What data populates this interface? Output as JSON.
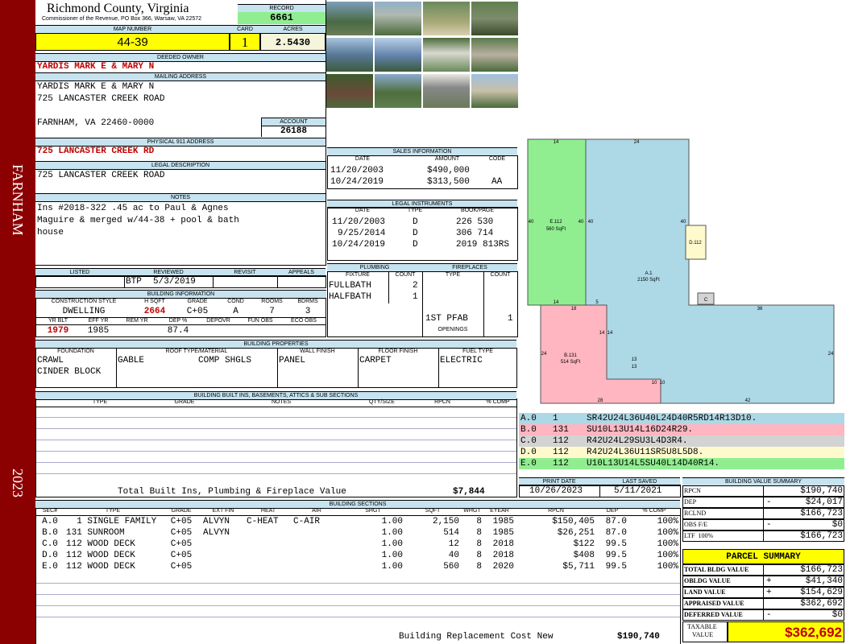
{
  "side_band": {
    "location": "FARNHAM",
    "year": "2023"
  },
  "header": {
    "county": "Richmond County, Virginia",
    "subtitle": "Commissioner of the Revenue, PO Box 366, Warsaw, VA 22572",
    "record_label": "RECORD",
    "record": "6661"
  },
  "parcel": {
    "map_label": "MAP NUMBER",
    "map_number": "44-39",
    "card_label": "CARD",
    "card": "1",
    "acres_label": "ACRES",
    "acres": "2.5430"
  },
  "owner": {
    "deeded_label": "DEEDED OWNER",
    "deeded": "YARDIS MARK E & MARY N",
    "mailing_label": "MAILING ADDRESS",
    "mailing_line1": "YARDIS MARK E & MARY N",
    "mailing_line2": "725 LANCASTER CREEK ROAD",
    "mailing_line3": "FARNHAM, VA 22460-0000",
    "account_label": "ACCOUNT",
    "account": "26188"
  },
  "physical": {
    "label": "PHYSICAL 911 ADDRESS",
    "address": "725 LANCASTER CREEK RD"
  },
  "legal": {
    "label": "LEGAL DESCRIPTION",
    "text": "725 LANCASTER CREEK ROAD"
  },
  "notes": {
    "label": "NOTES",
    "line1": "Ins #2018-322 .45 ac to Paul & Agnes",
    "line2": "Maguire & merged w/44-38 + pool & bath",
    "line3": "house"
  },
  "sales": {
    "label": "SALES INFORMATION",
    "cols": [
      "DATE",
      "AMOUNT",
      "CODE"
    ],
    "rows": [
      [
        "11/20/2003",
        "$490,000",
        ""
      ],
      [
        "10/24/2019",
        "$313,500",
        "AA"
      ]
    ]
  },
  "legal_instruments": {
    "label": "LEGAL INSTRUMENTS",
    "cols": [
      "DATE",
      "TYPE",
      "BOOK/PAGE"
    ],
    "rows": [
      [
        "11/20/2003",
        "D",
        "226 530"
      ],
      [
        "9/25/2014",
        "D",
        "306 714"
      ],
      [
        "10/24/2019",
        "D",
        "2019 813RS"
      ]
    ]
  },
  "listing": {
    "listed_label": "LISTED",
    "reviewed_label": "REVIEWED",
    "revisit_label": "REVISIT",
    "appeals_label": "APPEALS",
    "reviewer": "BTP",
    "reviewed": "5/3/2019"
  },
  "building_info": {
    "label": "BUILDING INFORMATION",
    "c1": "CONSTRUCTION STYLE",
    "c2": "H SQFT",
    "c3": "GRADE",
    "c4": "COND",
    "c5": "ROOMS",
    "c6": "BDRMS",
    "style": "DWELLING",
    "hsqft": "2664",
    "grade": "C+05",
    "cond": "A",
    "rooms": "7",
    "bdrms": "3",
    "d1": "YR BLT",
    "d2": "EFF YR",
    "d3": "REM YR",
    "d4": "DEP %",
    "d5": "DEPOVR",
    "d6": "FUN OBS",
    "d7": "ECO OBS",
    "yrblt": "1979",
    "effyr": "1985",
    "dep": "87.4"
  },
  "plumbing": {
    "label": "PLUMBING",
    "fixture_label": "FIXTURE",
    "count_label": "COUNT",
    "rows": [
      [
        "FULLBATH",
        "2"
      ],
      [
        "HALFBATH",
        "1"
      ]
    ]
  },
  "fireplaces": {
    "label": "FIREPLACES",
    "type_label": "TYPE",
    "count_label": "COUNT",
    "type": "1ST PFAB",
    "count": "1",
    "openings_label": "OPENINGS"
  },
  "properties": {
    "label": "BUILDING PROPERTIES",
    "foundation_label": "FOUNDATION",
    "roof_label": "ROOF TYPE/MATERIAL",
    "wall_label": "WALL FINISH",
    "floor_label": "FLOOR FINISH",
    "fuel_label": "FUEL TYPE",
    "foundation1": "CRAWL",
    "foundation2": "CINDER BLOCK",
    "roof_type": "GABLE",
    "roof_material": "COMP SHGLS",
    "wall": "PANEL",
    "floor": "CARPET",
    "fuel": "ELECTRIC"
  },
  "builtins": {
    "label": "BUILDING BUILT INS, BASEMENTS, ATTICS & SUB SECTIONS",
    "cols": [
      "TYPE",
      "GRADE",
      "NOTES",
      "QTY/SIZE",
      "RPCN",
      "% COMP"
    ],
    "total_label": "Total Built Ins, Plumbing & Fireplace Value",
    "total": "$7,844"
  },
  "dates": {
    "print_label": "PRINT DATE",
    "saved_label": "LAST SAVED",
    "print": "10/26/2023",
    "saved": "5/11/2021"
  },
  "sections": {
    "label": "BUILDING SECTIONS",
    "cols": [
      "SEC#",
      "TYPE",
      "GRADE",
      "EXT FIN",
      "HEAT",
      "AIR",
      "SHGT",
      "SQFT",
      "WHGT",
      "EYEAR",
      "RPCN",
      "DEP",
      "% COMP"
    ],
    "rows": [
      [
        "A.0",
        "  1 SINGLE FAMILY",
        "C+05",
        "ALVYN",
        "C-HEAT",
        "C-AIR",
        "1.00",
        "2,150",
        "8",
        "1985",
        "$150,405",
        "87.0",
        "100%"
      ],
      [
        "B.0",
        "131 SUNROOM",
        "C+05",
        "ALVYN",
        "",
        "",
        "1.00",
        "514",
        "8",
        "1985",
        "$26,251",
        "87.0",
        "100%"
      ],
      [
        "C.0",
        "112 WOOD DECK",
        "C+05",
        "",
        "",
        "",
        "1.00",
        "12",
        "8",
        "2018",
        "$122",
        "99.5",
        "100%"
      ],
      [
        "D.0",
        "112 WOOD DECK",
        "C+05",
        "",
        "",
        "",
        "1.00",
        "40",
        "8",
        "2018",
        "$408",
        "99.5",
        "100%"
      ],
      [
        "E.0",
        "112 WOOD DECK",
        "C+05",
        "",
        "",
        "",
        "1.00",
        "560",
        "8",
        "2020",
        "$5,711",
        "99.5",
        "100%"
      ]
    ],
    "replacement_label": "Building Replacement Cost New",
    "replacement": "$190,740"
  },
  "sketch": {
    "e_label": "E.112",
    "e_area": "560 SqFt",
    "a_label": "A.1",
    "a_area": "2150 SqFt",
    "b_label": "B.131",
    "b_area": "514 SqFt",
    "d_label": "D.112",
    "c_label": "C",
    "dims": [
      "14",
      "24",
      "40",
      "40",
      "40",
      "40",
      "14",
      "18",
      "5",
      "36",
      "14",
      "14",
      "24",
      "13",
      "13",
      "10",
      "10",
      "24",
      "28",
      "42"
    ],
    "rows": [
      {
        "sec": "A.0",
        "code": "1",
        "vectors": "SR42U24L36U40L24D40R5RD14R13D10.",
        "color": "#add8e6"
      },
      {
        "sec": "B.0",
        "code": "131",
        "vectors": "SU10L13U14L16D24R29.",
        "color": "#ffb6c1"
      },
      {
        "sec": "C.0",
        "code": "112",
        "vectors": "R42U24L29SU3L4D3R4.",
        "color": "#d3d3d3"
      },
      {
        "sec": "D.0",
        "code": "112",
        "vectors": "R42U24L36U11SR5U8L5D8.",
        "color": "#fffacd"
      },
      {
        "sec": "E.0",
        "code": "112",
        "vectors": "U10L13U14L5SU40L14D40R14.",
        "color": "#90ee90"
      }
    ]
  },
  "value_summary": {
    "label": "BUILDING VALUE SUMMARY",
    "rows": [
      [
        "RPCN",
        "",
        "$190,740"
      ],
      [
        "DEP",
        "-",
        "$24,017"
      ],
      [
        "RCLND",
        "",
        "$166,723"
      ],
      [
        "OBS F/E",
        "-",
        "$0"
      ],
      [
        "LTF  100%",
        "",
        "$166,723"
      ]
    ]
  },
  "parcel_summary": {
    "label": "PARCEL SUMMARY",
    "rows": [
      [
        "TOTAL BLDG VALUE",
        "",
        "$166,723"
      ],
      [
        "OBLDG VALUE",
        "+",
        "$41,340"
      ],
      [
        "LAND VALUE",
        "+",
        "$154,629"
      ],
      [
        "APPRAISED VALUE",
        "",
        "$362,692"
      ],
      [
        "DEFERRED VALUE",
        "-",
        "$0"
      ]
    ],
    "taxable_label1": "TAXABLE",
    "taxable_label2": "VALUE",
    "taxable": "$362,692"
  },
  "colors": {
    "band": "#8b0000",
    "header_bg": "#c6e3ef",
    "highlight": "#ffff00",
    "record_bg": "#90ee90",
    "value_red": "#c00000"
  }
}
